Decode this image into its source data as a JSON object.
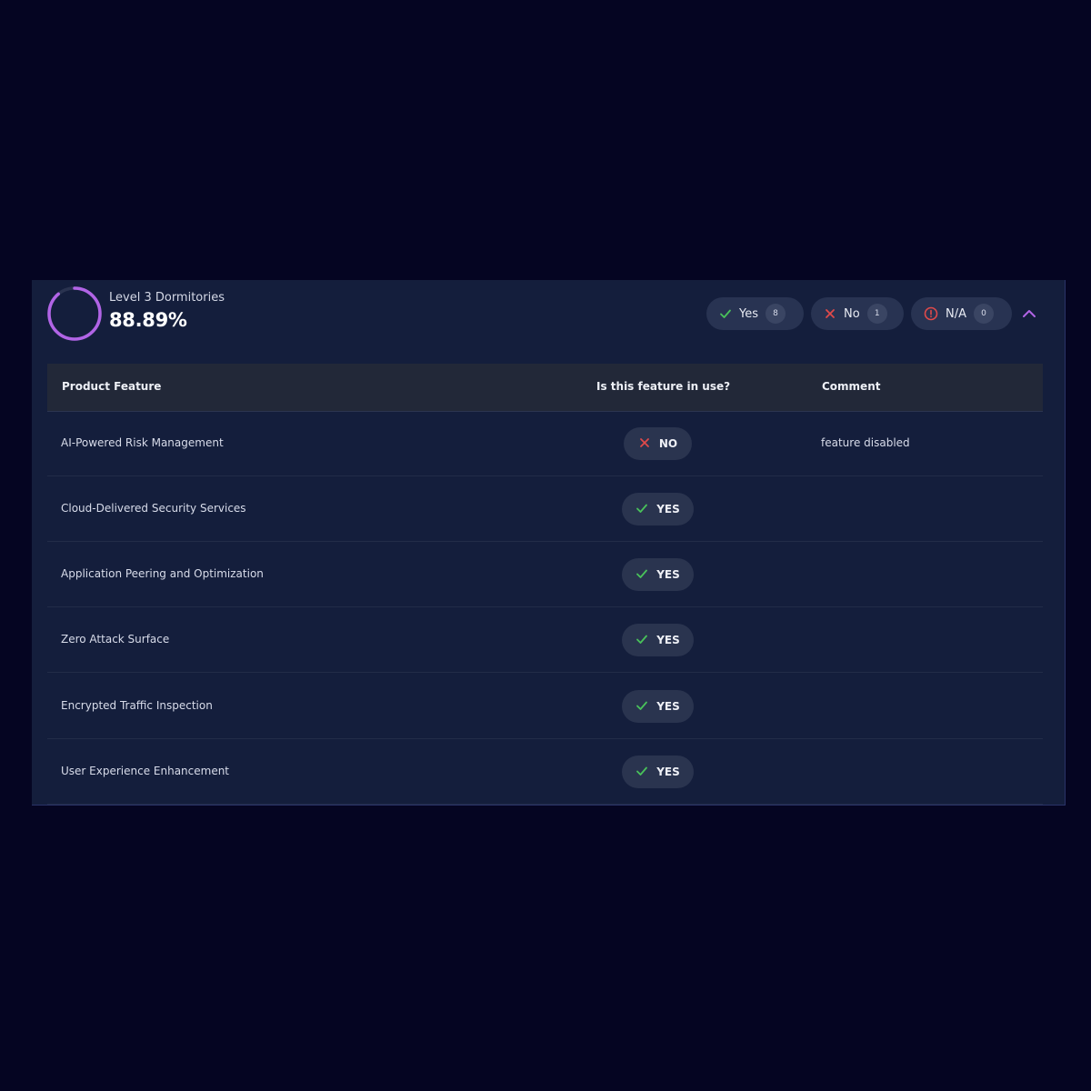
{
  "section": {
    "title": "Level 3 Dormitories",
    "percentage": "88.89%",
    "progress_fraction": 0.8889,
    "accent_color": "#b164e6"
  },
  "summary": {
    "yes": {
      "label": "Yes",
      "count": "8",
      "icon": "check-icon",
      "color": "#49c25a"
    },
    "no": {
      "label": "No",
      "count": "1",
      "icon": "x-icon",
      "color": "#e04a4a"
    },
    "na": {
      "label": "N/A",
      "count": "0",
      "icon": "alert-circle-icon",
      "color": "#e04a4a"
    },
    "collapse_icon": "chevron-up-icon"
  },
  "table": {
    "headers": {
      "feature": "Product Feature",
      "in_use": "Is this feature in use?",
      "comment": "Comment"
    },
    "rows": [
      {
        "feature": "AI-Powered Risk Management",
        "status": "NO",
        "comment": "feature disabled"
      },
      {
        "feature": "Cloud-Delivered Security Services",
        "status": "YES",
        "comment": ""
      },
      {
        "feature": "Application Peering and Optimization",
        "status": "YES",
        "comment": ""
      },
      {
        "feature": "Zero Attack Surface",
        "status": "YES",
        "comment": ""
      },
      {
        "feature": "Encrypted Traffic Inspection",
        "status": "YES",
        "comment": ""
      },
      {
        "feature": "User Experience Enhancement",
        "status": "YES",
        "comment": ""
      }
    ]
  }
}
